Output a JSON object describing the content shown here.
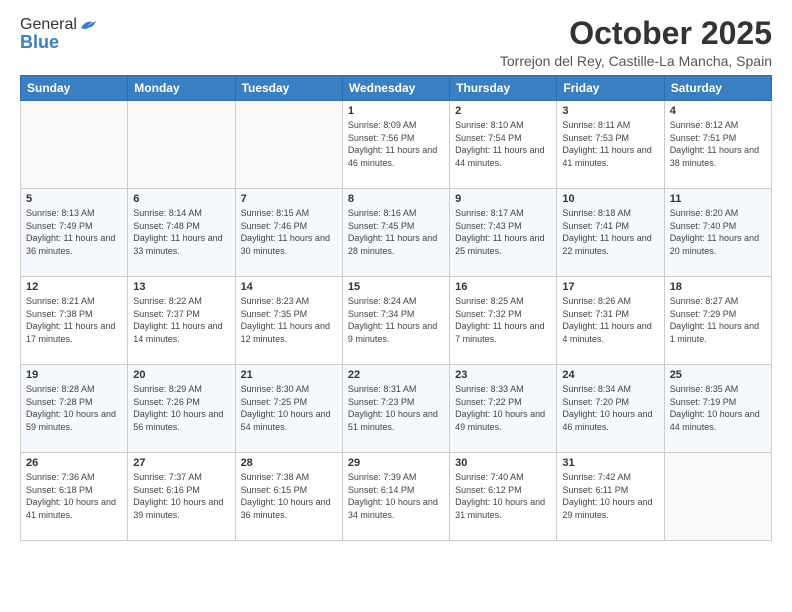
{
  "header": {
    "logo_general": "General",
    "logo_blue": "Blue",
    "month": "October 2025",
    "location": "Torrejon del Rey, Castille-La Mancha, Spain"
  },
  "weekdays": [
    "Sunday",
    "Monday",
    "Tuesday",
    "Wednesday",
    "Thursday",
    "Friday",
    "Saturday"
  ],
  "weeks": [
    [
      {
        "day": "",
        "info": ""
      },
      {
        "day": "",
        "info": ""
      },
      {
        "day": "",
        "info": ""
      },
      {
        "day": "1",
        "info": "Sunrise: 8:09 AM\nSunset: 7:56 PM\nDaylight: 11 hours and 46 minutes."
      },
      {
        "day": "2",
        "info": "Sunrise: 8:10 AM\nSunset: 7:54 PM\nDaylight: 11 hours and 44 minutes."
      },
      {
        "day": "3",
        "info": "Sunrise: 8:11 AM\nSunset: 7:53 PM\nDaylight: 11 hours and 41 minutes."
      },
      {
        "day": "4",
        "info": "Sunrise: 8:12 AM\nSunset: 7:51 PM\nDaylight: 11 hours and 38 minutes."
      }
    ],
    [
      {
        "day": "5",
        "info": "Sunrise: 8:13 AM\nSunset: 7:49 PM\nDaylight: 11 hours and 36 minutes."
      },
      {
        "day": "6",
        "info": "Sunrise: 8:14 AM\nSunset: 7:48 PM\nDaylight: 11 hours and 33 minutes."
      },
      {
        "day": "7",
        "info": "Sunrise: 8:15 AM\nSunset: 7:46 PM\nDaylight: 11 hours and 30 minutes."
      },
      {
        "day": "8",
        "info": "Sunrise: 8:16 AM\nSunset: 7:45 PM\nDaylight: 11 hours and 28 minutes."
      },
      {
        "day": "9",
        "info": "Sunrise: 8:17 AM\nSunset: 7:43 PM\nDaylight: 11 hours and 25 minutes."
      },
      {
        "day": "10",
        "info": "Sunrise: 8:18 AM\nSunset: 7:41 PM\nDaylight: 11 hours and 22 minutes."
      },
      {
        "day": "11",
        "info": "Sunrise: 8:20 AM\nSunset: 7:40 PM\nDaylight: 11 hours and 20 minutes."
      }
    ],
    [
      {
        "day": "12",
        "info": "Sunrise: 8:21 AM\nSunset: 7:38 PM\nDaylight: 11 hours and 17 minutes."
      },
      {
        "day": "13",
        "info": "Sunrise: 8:22 AM\nSunset: 7:37 PM\nDaylight: 11 hours and 14 minutes."
      },
      {
        "day": "14",
        "info": "Sunrise: 8:23 AM\nSunset: 7:35 PM\nDaylight: 11 hours and 12 minutes."
      },
      {
        "day": "15",
        "info": "Sunrise: 8:24 AM\nSunset: 7:34 PM\nDaylight: 11 hours and 9 minutes."
      },
      {
        "day": "16",
        "info": "Sunrise: 8:25 AM\nSunset: 7:32 PM\nDaylight: 11 hours and 7 minutes."
      },
      {
        "day": "17",
        "info": "Sunrise: 8:26 AM\nSunset: 7:31 PM\nDaylight: 11 hours and 4 minutes."
      },
      {
        "day": "18",
        "info": "Sunrise: 8:27 AM\nSunset: 7:29 PM\nDaylight: 11 hours and 1 minute."
      }
    ],
    [
      {
        "day": "19",
        "info": "Sunrise: 8:28 AM\nSunset: 7:28 PM\nDaylight: 10 hours and 59 minutes."
      },
      {
        "day": "20",
        "info": "Sunrise: 8:29 AM\nSunset: 7:26 PM\nDaylight: 10 hours and 56 minutes."
      },
      {
        "day": "21",
        "info": "Sunrise: 8:30 AM\nSunset: 7:25 PM\nDaylight: 10 hours and 54 minutes."
      },
      {
        "day": "22",
        "info": "Sunrise: 8:31 AM\nSunset: 7:23 PM\nDaylight: 10 hours and 51 minutes."
      },
      {
        "day": "23",
        "info": "Sunrise: 8:33 AM\nSunset: 7:22 PM\nDaylight: 10 hours and 49 minutes."
      },
      {
        "day": "24",
        "info": "Sunrise: 8:34 AM\nSunset: 7:20 PM\nDaylight: 10 hours and 46 minutes."
      },
      {
        "day": "25",
        "info": "Sunrise: 8:35 AM\nSunset: 7:19 PM\nDaylight: 10 hours and 44 minutes."
      }
    ],
    [
      {
        "day": "26",
        "info": "Sunrise: 7:36 AM\nSunset: 6:18 PM\nDaylight: 10 hours and 41 minutes."
      },
      {
        "day": "27",
        "info": "Sunrise: 7:37 AM\nSunset: 6:16 PM\nDaylight: 10 hours and 39 minutes."
      },
      {
        "day": "28",
        "info": "Sunrise: 7:38 AM\nSunset: 6:15 PM\nDaylight: 10 hours and 36 minutes."
      },
      {
        "day": "29",
        "info": "Sunrise: 7:39 AM\nSunset: 6:14 PM\nDaylight: 10 hours and 34 minutes."
      },
      {
        "day": "30",
        "info": "Sunrise: 7:40 AM\nSunset: 6:12 PM\nDaylight: 10 hours and 31 minutes."
      },
      {
        "day": "31",
        "info": "Sunrise: 7:42 AM\nSunset: 6:11 PM\nDaylight: 10 hours and 29 minutes."
      },
      {
        "day": "",
        "info": ""
      }
    ]
  ]
}
